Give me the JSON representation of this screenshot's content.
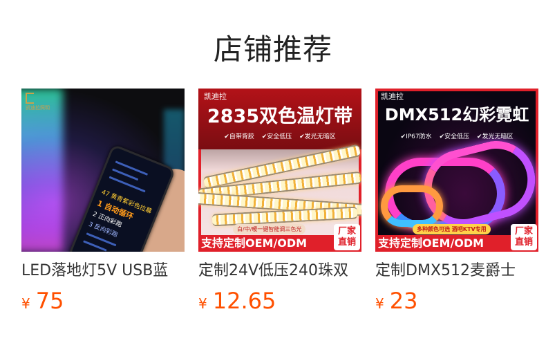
{
  "section": {
    "title": "店铺推荐"
  },
  "products": [
    {
      "name": "LED落地灯5V USB蓝",
      "currency": "¥",
      "price": "75",
      "image": {
        "logo_text": "凯迪拉照明",
        "screen_lines": [
          "47 黄青紫彩色拉幕",
          "1 自动循环",
          "2 正向彩跑",
          "3 反向彩跑"
        ]
      }
    },
    {
      "name": "定制24V低压240珠双",
      "currency": "¥",
      "price": "12.65",
      "image": {
        "brand": "凯迪拉",
        "headline": "2835双色温灯带",
        "features": [
          "✔自带背胶",
          "✔安全低压",
          "✔发光无暗区"
        ],
        "pill": "白/中/暖一键智能调三色光",
        "oem": "支持定制OEM/ODM",
        "badge": [
          "厂家",
          "直销"
        ],
        "colors": {
          "accent": "#e0202a"
        }
      }
    },
    {
      "name": "定制DMX512麦爵士",
      "currency": "¥",
      "price": "23",
      "image": {
        "brand": "凯迪拉",
        "headline": "DMX512幻彩霓虹",
        "features": [
          "✔IP67防水",
          "✔安全低压",
          "✔发光无暗区"
        ],
        "pill": "多种颜色可选 酒吧KTV专用",
        "oem": "支持定制OEM/ODM",
        "badge": [
          "厂家",
          "直销"
        ],
        "colors": {
          "accent": "#e0202a"
        }
      }
    }
  ],
  "colors": {
    "price": "#ff5000",
    "title": "#222222",
    "name": "#333333"
  }
}
